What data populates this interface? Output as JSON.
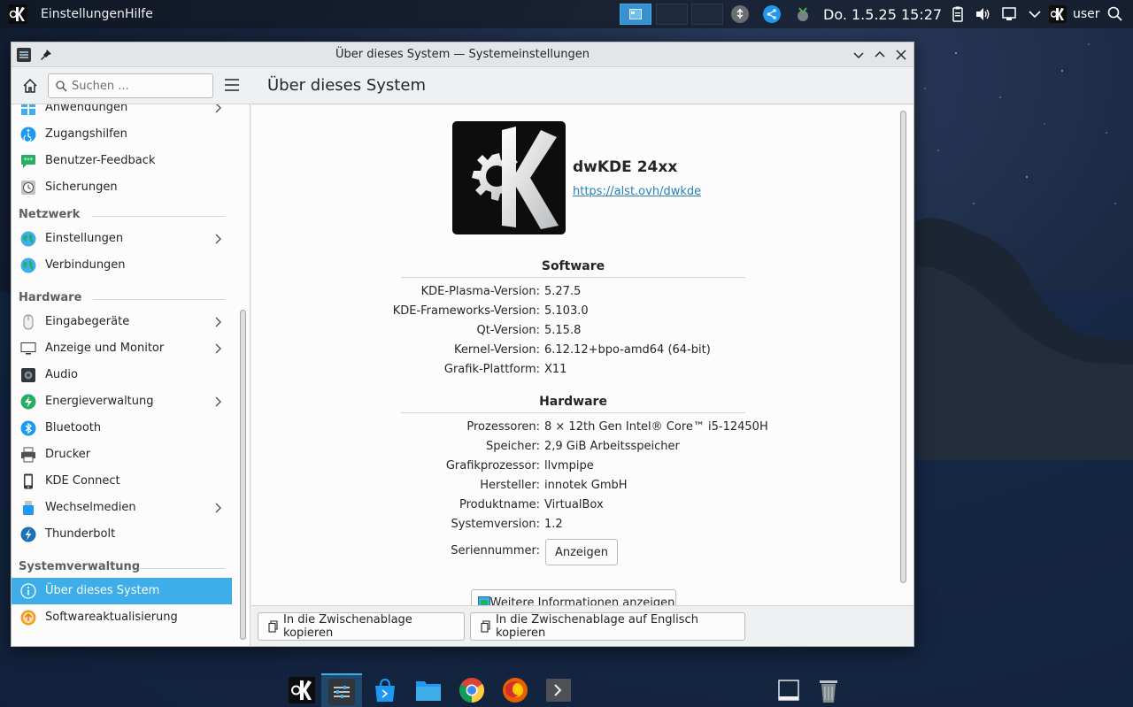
{
  "top_panel": {
    "menu": [
      "Einstellungen",
      "Hilfe"
    ],
    "clock": "Do. 1.5.25 15:27",
    "user": "user"
  },
  "window": {
    "title": "Über dieses System — Systemeinstellungen"
  },
  "sidebar": {
    "search_placeholder": "Suchen ...",
    "partial_item": "Anwendungen",
    "items_top": [
      "Zugangshilfen",
      "Benutzer-Feedback",
      "Sicherungen"
    ],
    "section_network": "Netzwerk",
    "network_items": [
      "Einstellungen",
      "Verbindungen"
    ],
    "section_hardware": "Hardware",
    "hardware_items": [
      "Eingabegeräte",
      "Anzeige und Monitor",
      "Audio",
      "Energieverwaltung",
      "Bluetooth",
      "Drucker",
      "KDE Connect",
      "Wechselmedien",
      "Thunderbolt"
    ],
    "section_admin": "Systemverwaltung",
    "admin_items": [
      "Über dieses System",
      "Softwareaktualisierung"
    ]
  },
  "content": {
    "page_title": "Über dieses System",
    "distro_name": "dwKDE 24xx",
    "distro_url": "https://alst.ovh/dwkde",
    "software_heading": "Software",
    "software": [
      {
        "key": "KDE-Plasma-Version:",
        "value": "5.27.5"
      },
      {
        "key": "KDE-Frameworks-Version:",
        "value": "5.103.0"
      },
      {
        "key": "Qt-Version:",
        "value": "5.15.8"
      },
      {
        "key": "Kernel-Version:",
        "value": "6.12.12+bpo-amd64 (64-bit)"
      },
      {
        "key": "Grafik-Plattform:",
        "value": "X11"
      }
    ],
    "hardware_heading": "Hardware",
    "hardware": [
      {
        "key": "Prozessoren:",
        "value": "8 × 12th Gen Intel® Core™ i5-12450H"
      },
      {
        "key": "Speicher:",
        "value": "2,9 GiB Arbeitsspeicher"
      },
      {
        "key": "Grafikprozessor:",
        "value": "llvmpipe"
      },
      {
        "key": "Hersteller:",
        "value": "innotek GmbH"
      },
      {
        "key": "Produktname:",
        "value": "VirtualBox"
      },
      {
        "key": "Systemversion:",
        "value": "1.2"
      }
    ],
    "serial_key": "Seriennummer:",
    "serial_button": "Anzeigen",
    "more_info_button": "Weitere Informationen anzeigen"
  },
  "footer": {
    "copy_button": "In die Zwischenablage kopieren",
    "copy_english_button": "In die Zwischenablage auf Englisch kopieren"
  },
  "colors": {
    "accent": "#3daee9",
    "link": "#2980b9",
    "panel_bg": "#10161e"
  }
}
